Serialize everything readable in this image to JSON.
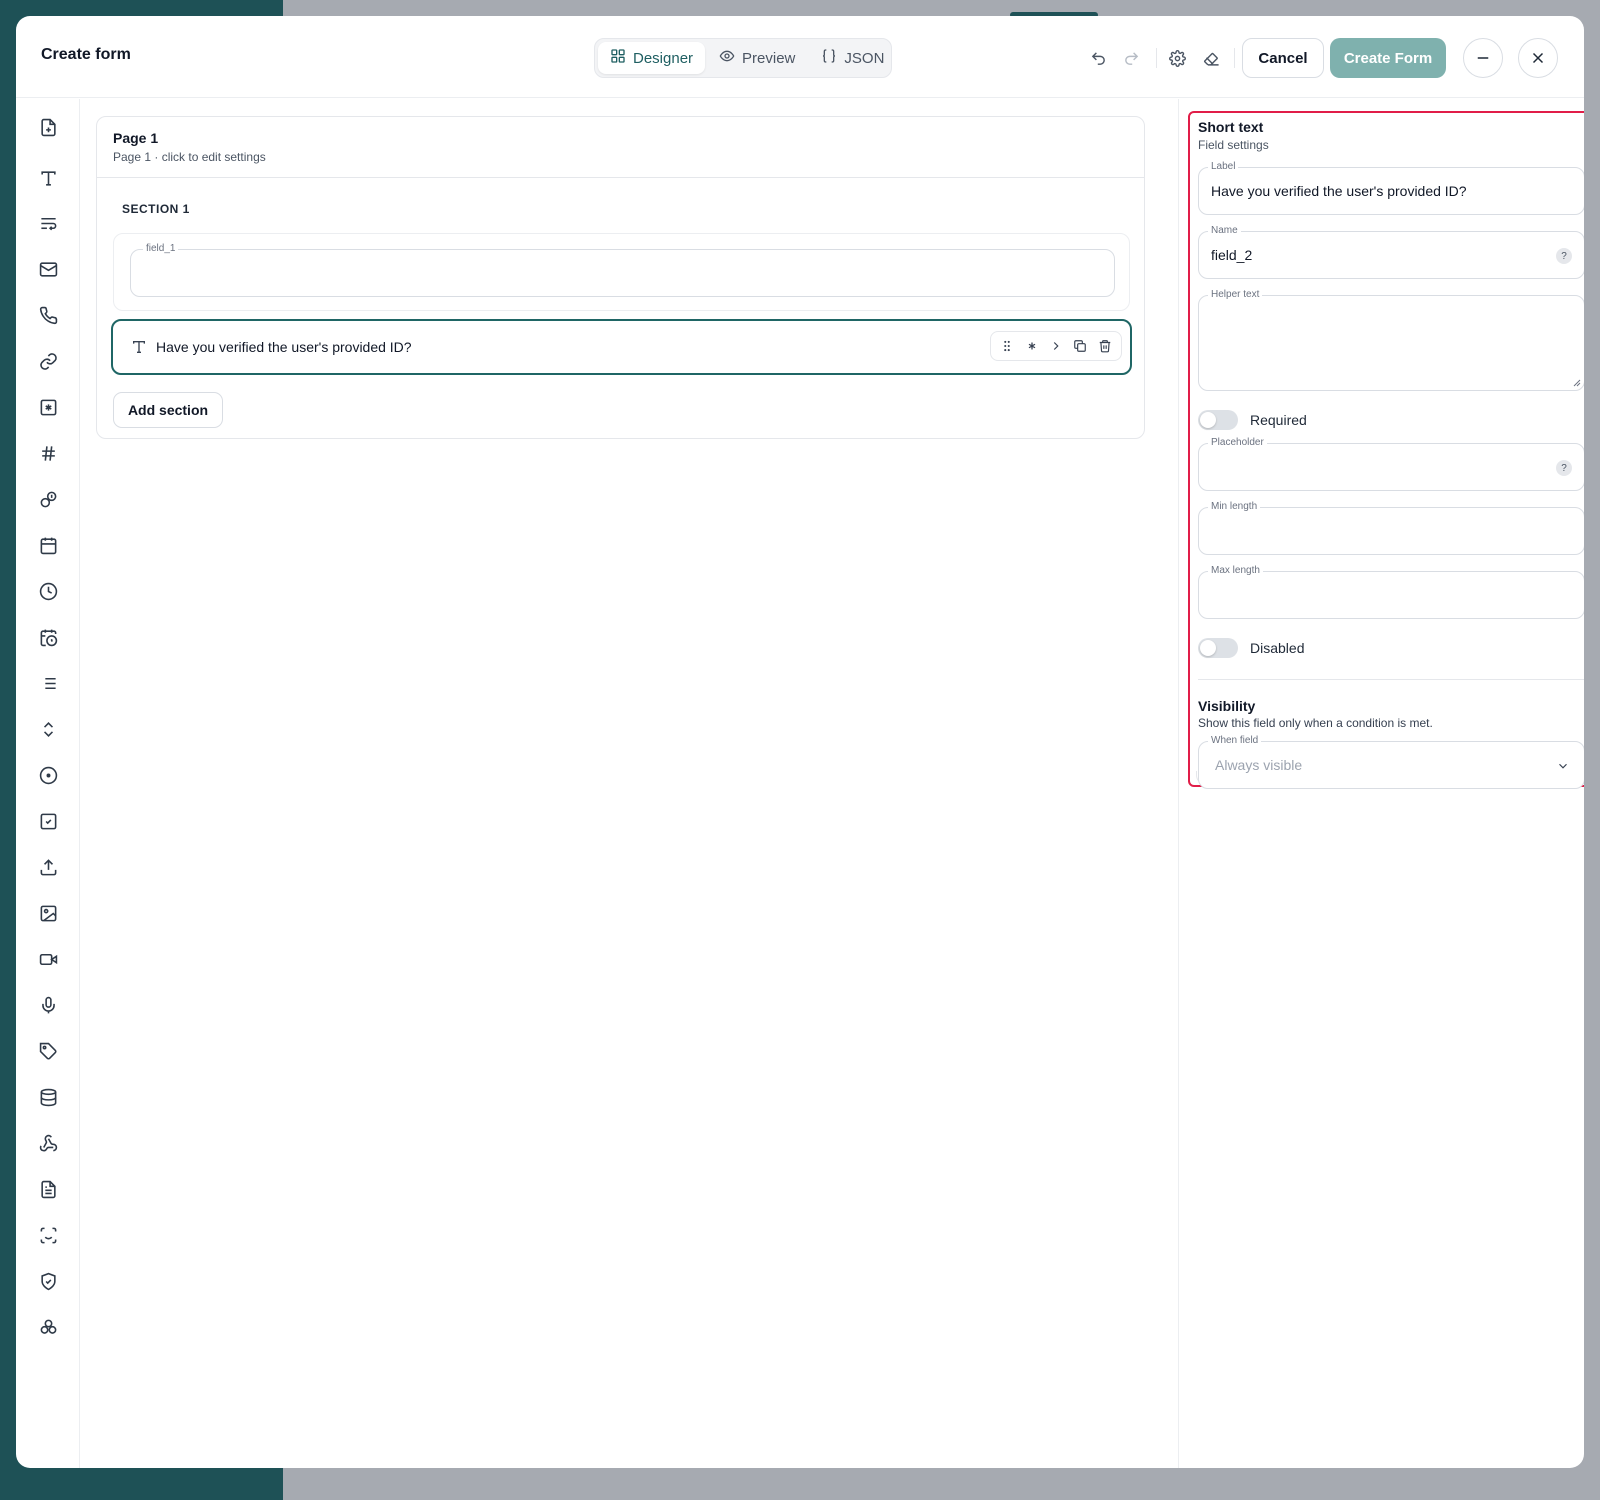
{
  "header": {
    "title": "Create form",
    "modes": [
      {
        "label": "Designer",
        "icon": "grid-icon",
        "active": true
      },
      {
        "label": "Preview",
        "icon": "eye-icon",
        "active": false
      },
      {
        "label": "JSON",
        "icon": "braces-icon",
        "active": false
      }
    ],
    "cancel_label": "Cancel",
    "create_label": "Create Form"
  },
  "rail": {
    "icons": [
      "file-plus-icon",
      "text-icon",
      "wrap-text-icon",
      "mail-icon",
      "phone-icon",
      "link-icon",
      "asterisk-square-icon",
      "hash-icon",
      "coins-icon",
      "calendar-icon",
      "clock-icon",
      "calendar-clock-icon",
      "list-icon",
      "chevrons-up-down-icon",
      "radio-icon",
      "checkbox-icon",
      "upload-icon",
      "image-icon",
      "video-icon",
      "mic-icon",
      "tag-icon",
      "database-icon",
      "webhook-icon",
      "file-text-icon",
      "scan-face-icon",
      "shield-check-icon",
      "component-icon"
    ]
  },
  "canvas": {
    "page_title": "Page 1",
    "page_subtitle": "Page 1 · click to edit settings",
    "section_label": "SECTION 1",
    "field1_label": "field_1",
    "field2_label": "Have you verified the user's provided ID?",
    "add_section_label": "Add section"
  },
  "panel": {
    "title": "Short text",
    "subtitle": "Field settings",
    "label_caption": "Label",
    "label_value": "Have you verified the user's provided ID?",
    "name_caption": "Name",
    "name_value": "field_2",
    "help_symbol": "?",
    "helper_caption": "Helper text",
    "required_label": "Required",
    "placeholder_caption": "Placeholder",
    "min_caption": "Min length",
    "max_caption": "Max length",
    "disabled_label": "Disabled",
    "visibility_title": "Visibility",
    "visibility_sub": "Show this field only when a condition is met.",
    "when_caption": "When field",
    "when_value": "Always visible"
  },
  "colors": {
    "accent": "#1f6665",
    "create_button": "#7fb1ae",
    "highlight": "#e11d48"
  }
}
